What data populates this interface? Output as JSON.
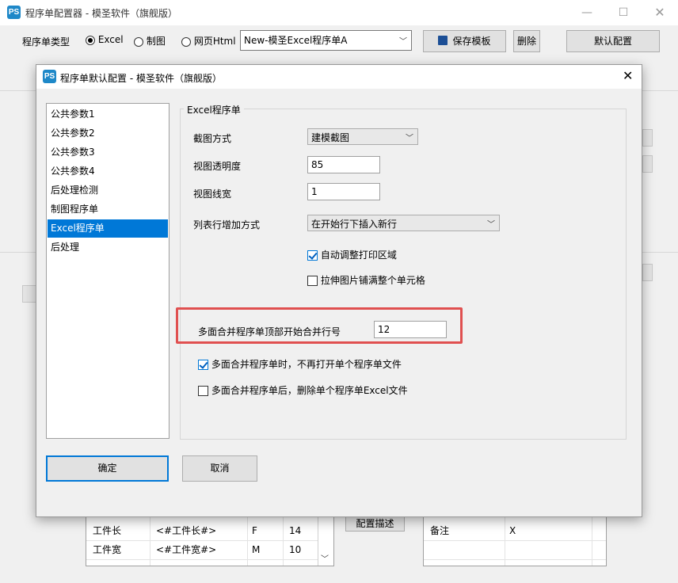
{
  "main_window": {
    "title": "程序单配置器 - 模圣软件（旗舰版）",
    "toolbar": {
      "type_label": "程序单类型",
      "radio_excel": "Excel",
      "radio_drawing": "制图",
      "radio_web": "网页Html",
      "selected_type": "Excel",
      "template_value": "New-模圣Excel程序单A",
      "save_template": "保存模板",
      "delete": "删除",
      "default_config": "默认配置"
    },
    "config_desc_button": "配置描述",
    "left_table": {
      "rows": [
        {
          "name": "工件长",
          "token": "<#工件长#>",
          "code": "F",
          "size": "14"
        },
        {
          "name": "工件宽",
          "token": "<#工件宽#>",
          "code": "M",
          "size": "10"
        }
      ]
    },
    "right_table": {
      "rows": [
        {
          "name": "备注",
          "value": "X"
        }
      ]
    }
  },
  "dialog": {
    "title": "程序单默认配置 - 模圣软件（旗舰版）",
    "nav": [
      "公共参数1",
      "公共参数2",
      "公共参数3",
      "公共参数4",
      "后处理检测",
      "制图程序单",
      "Excel程序单",
      "后处理"
    ],
    "selected_nav": "Excel程序单",
    "group_title": "Excel程序单",
    "fields": {
      "capture_label": "截图方式",
      "capture_value": "建模截图",
      "opacity_label": "视图透明度",
      "opacity_value": "85",
      "linewidth_label": "视图线宽",
      "linewidth_value": "1",
      "rowadd_label": "列表行增加方式",
      "rowadd_value": "在开始行下插入新行",
      "auto_print_label": "自动调整打印区域",
      "auto_print_checked": true,
      "stretch_label": "拉伸图片铺满整个单元格",
      "stretch_checked": false,
      "merge_row_label": "多面合并程序单顶部开始合并行号",
      "merge_row_value": "12",
      "no_open_label": "多面合并程序单时，不再打开单个程序单文件",
      "no_open_checked": true,
      "delete_single_label": "多面合并程序单后，删除单个程序单Excel文件",
      "delete_single_checked": false
    },
    "ok": "确定",
    "cancel": "取消"
  },
  "colors": {
    "accent": "#0078d7",
    "highlight": "#e05050",
    "logo": "#1e88c8"
  }
}
